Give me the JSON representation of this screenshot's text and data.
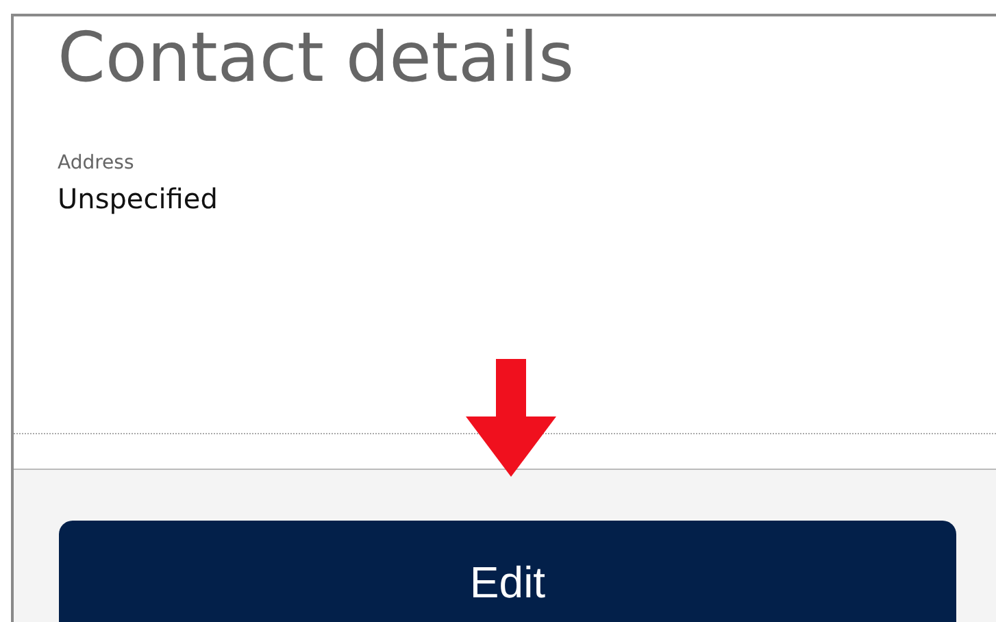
{
  "section": {
    "title": "Contact details"
  },
  "fields": [
    {
      "label": "Address",
      "value": "Unspecified"
    }
  ],
  "buttons": [
    {
      "label": "Edit"
    }
  ]
}
